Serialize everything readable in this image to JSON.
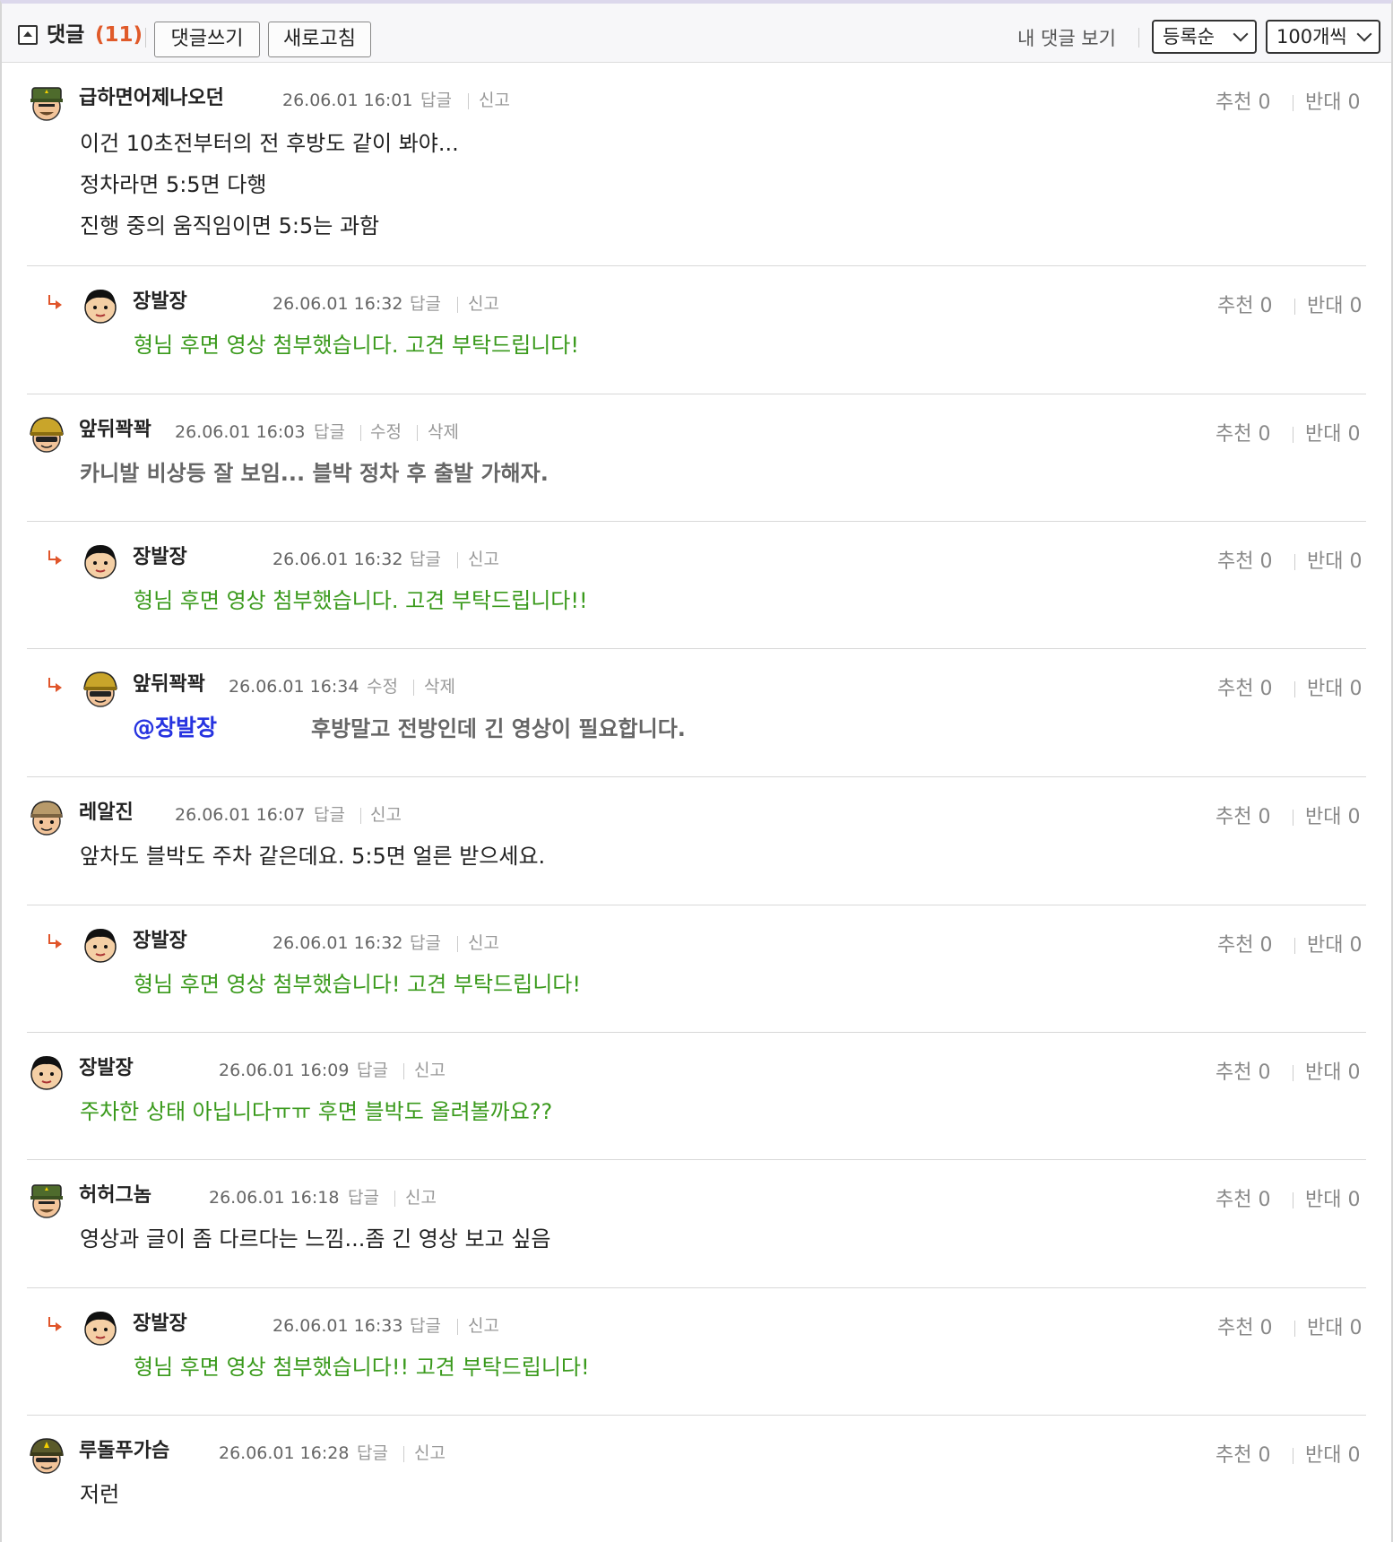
{
  "header": {
    "title": "댓글",
    "count": "(11)",
    "write_button": "댓글쓰기",
    "refresh_button": "새로고침",
    "my_comments_link": "내 댓글 보기",
    "sort_select": "등록순",
    "per_page_select": "100개씩"
  },
  "comments": [
    {
      "author": "급하면어제나오던",
      "date": "26.06.01 16:01",
      "actions": [
        "답글",
        "신고"
      ],
      "recommend": "추천 0",
      "oppose": "반대 0",
      "lines": [
        "이건 10초전부터의 전 후방도 같이 봐야...",
        "정차라면 5:5면 다행",
        "진행 중의 움직임이면 5:5는 과함"
      ],
      "avatar_icon": "soldier-avatar-icon"
    },
    {
      "author": "장발장",
      "date": "26.06.01 16:32",
      "actions": [
        "답글",
        "신고"
      ],
      "recommend": "추천 0",
      "oppose": "반대 0",
      "lines": [
        "형님 후면 영상 첨부했습니다. 고견 부탁드립니다!"
      ],
      "avatar_icon": "boy-avatar-icon"
    },
    {
      "author": "앞뒤꽉꽉",
      "date": "26.06.01 16:03",
      "actions": [
        "답글",
        "수정",
        "삭제"
      ],
      "recommend": "추천 0",
      "oppose": "반대 0",
      "lines": [
        "카니발 비상등 잘 보임... 블박 정차 후 출발 가해자."
      ],
      "avatar_icon": "helmet-avatar-icon"
    },
    {
      "author": "장발장",
      "date": "26.06.01 16:32",
      "actions": [
        "답글",
        "신고"
      ],
      "recommend": "추천 0",
      "oppose": "반대 0",
      "lines": [
        "형님 후면 영상 첨부했습니다. 고견 부탁드립니다!!"
      ],
      "avatar_icon": "boy-avatar-icon"
    },
    {
      "author": "앞뒤꽉꽉",
      "date": "26.06.01 16:34",
      "actions": [
        "수정",
        "삭제"
      ],
      "recommend": "추천 0",
      "oppose": "반대 0",
      "mention": "@장발장",
      "lines": [
        "후방말고 전방인데 긴 영상이 필요합니다."
      ],
      "avatar_icon": "helmet-avatar-icon"
    },
    {
      "author": "레알진",
      "date": "26.06.01 16:07",
      "actions": [
        "답글",
        "신고"
      ],
      "recommend": "추천 0",
      "oppose": "반대 0",
      "lines": [
        "앞차도 블박도 주차 같은데요. 5:5면 얼른 받으세요."
      ],
      "avatar_icon": "cap-avatar-icon"
    },
    {
      "author": "장발장",
      "date": "26.06.01 16:32",
      "actions": [
        "답글",
        "신고"
      ],
      "recommend": "추천 0",
      "oppose": "반대 0",
      "lines": [
        "형님 후면 영상 첨부했습니다! 고견 부탁드립니다!"
      ],
      "avatar_icon": "boy-avatar-icon"
    },
    {
      "author": "장발장",
      "date": "26.06.01 16:09",
      "actions": [
        "답글",
        "신고"
      ],
      "recommend": "추천 0",
      "oppose": "반대 0",
      "lines": [
        "주차한 상태 아닙니다ㅠㅠ 후면 블박도 올려볼까요??"
      ],
      "avatar_icon": "boy-avatar-icon"
    },
    {
      "author": "허허그놈",
      "date": "26.06.01 16:18",
      "actions": [
        "답글",
        "신고"
      ],
      "recommend": "추천 0",
      "oppose": "반대 0",
      "lines": [
        "영상과 글이 좀 다르다는 느낌...좀 긴 영상 보고 싶음"
      ],
      "avatar_icon": "soldier-avatar-icon"
    },
    {
      "author": "장발장",
      "date": "26.06.01 16:33",
      "actions": [
        "답글",
        "신고"
      ],
      "recommend": "추천 0",
      "oppose": "반대 0",
      "lines": [
        "형님 후면 영상 첨부했습니다!! 고견 부탁드립니다!"
      ],
      "avatar_icon": "boy-avatar-icon"
    },
    {
      "author": "루돌푸가슴",
      "date": "26.06.01 16:28",
      "actions": [
        "답글",
        "신고"
      ],
      "recommend": "추천 0",
      "oppose": "반대 0",
      "lines": [
        "저런"
      ],
      "avatar_icon": "general-avatar-icon"
    }
  ],
  "colors": {
    "count_orange": "#e05a2a",
    "reply_green": "#3a9a1c",
    "mention_blue": "#2633e0",
    "reply_arrow": "#e0552a"
  }
}
